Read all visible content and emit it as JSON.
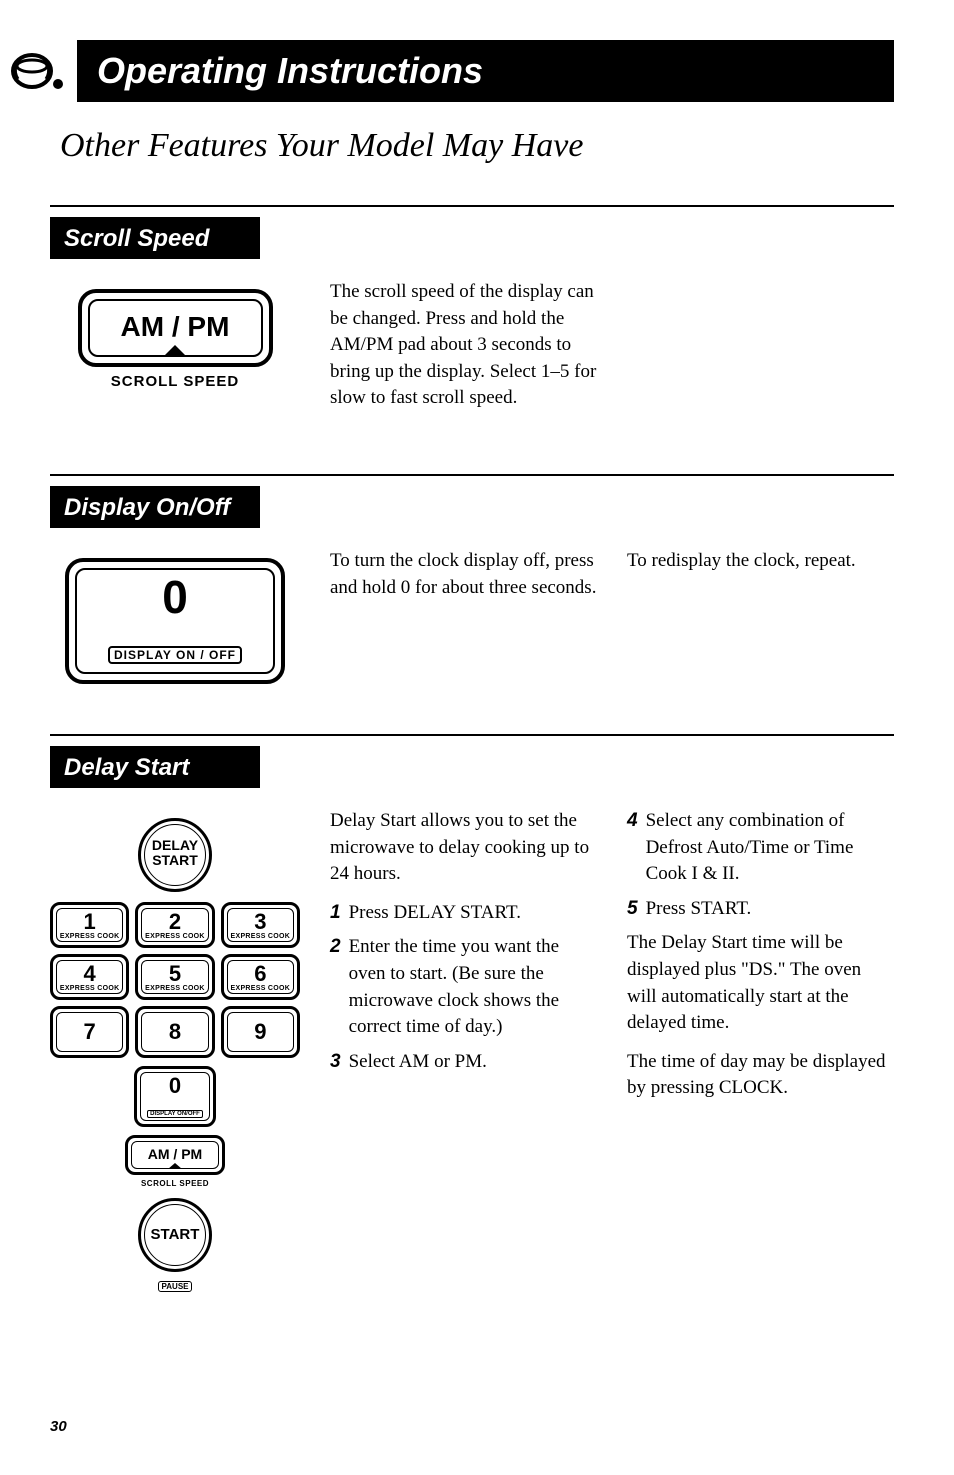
{
  "header": {
    "title": "Operating Instructions"
  },
  "pageTitle": "Other Features Your Model May Have",
  "sections": {
    "scrollSpeed": {
      "heading": "Scroll Speed",
      "imageLabels": {
        "button": "AM / PM",
        "sublabel": "SCROLL SPEED"
      },
      "body": "The scroll speed of the display can be changed. Press and hold the AM/PM pad about 3 seconds to bring up the display. Select 1–5 for slow to fast scroll speed."
    },
    "displayOnOff": {
      "heading": "Display On/Off",
      "imageLabels": {
        "button": "0",
        "sublabel": "DISPLAY ON / OFF"
      },
      "col1": "To turn the clock display off, press and hold 0 for about three seconds.",
      "col2": "To redisplay the clock, repeat."
    },
    "delayStart": {
      "heading": "Delay Start",
      "imageLabels": {
        "delayStart": "DELAY\nSTART",
        "express": "EXPRESS COOK",
        "displayOnOff": "DISPLAY ON/OFF",
        "ampm": "AM / PM",
        "scrollSpeed": "SCROLL SPEED",
        "start": "START",
        "pause": "PAUSE",
        "keys": [
          "1",
          "2",
          "3",
          "4",
          "5",
          "6",
          "7",
          "8",
          "9",
          "0"
        ]
      },
      "col1": {
        "intro": "Delay Start allows you to set the microwave to delay cooking up to 24 hours.",
        "steps": [
          {
            "num": "1",
            "text": "Press DELAY START."
          },
          {
            "num": "2",
            "text": "Enter the time you want the oven to start. (Be sure the microwave clock shows the correct time of day.)"
          },
          {
            "num": "3",
            "text": "Select AM or PM."
          }
        ]
      },
      "col2": {
        "steps": [
          {
            "num": "4",
            "text": "Select any combination of Defrost Auto/Time or Time Cook I & II."
          },
          {
            "num": "5",
            "text": "Press START."
          }
        ],
        "para1": "The Delay Start time will be displayed plus \"DS.\" The oven will automatically start at the delayed time.",
        "para2": "The time of day may be displayed by pressing CLOCK."
      }
    }
  },
  "pageNumber": "30"
}
